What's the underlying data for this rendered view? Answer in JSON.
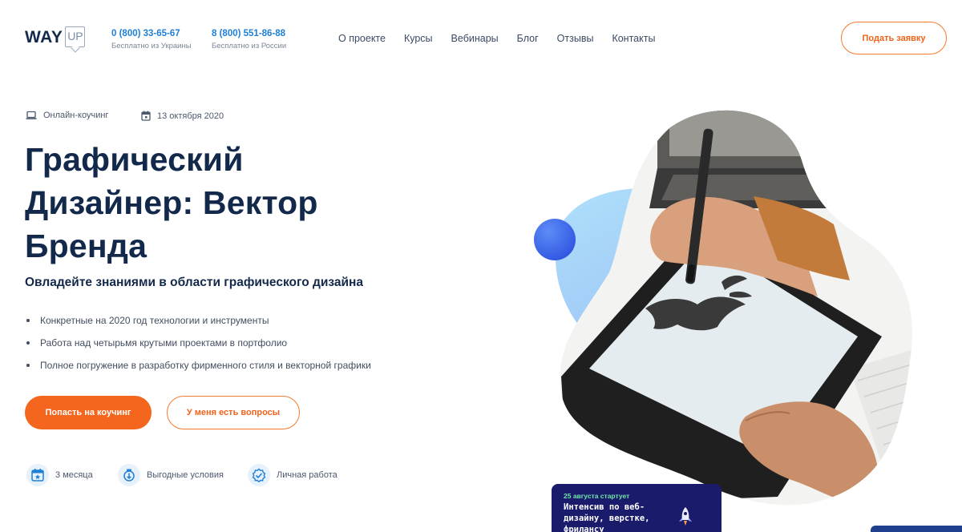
{
  "header": {
    "logo": {
      "way": "WAY",
      "up": "UP"
    },
    "phones": [
      {
        "number": "0 (800) 33-65-67",
        "note": "Бесплатно из Украины"
      },
      {
        "number": "8 (800) 551-86-88",
        "note": "Бесплатно из России"
      }
    ],
    "nav": [
      "О проекте",
      "Курсы",
      "Вебинары",
      "Блог",
      "Отзывы",
      "Контакты"
    ],
    "apply_button": "Подать заявку"
  },
  "meta": {
    "format": "Онлайн-коучинг",
    "date": "13 октября 2020"
  },
  "hero": {
    "title": "Графический Дизайнер: Вектор Бренда",
    "subtitle": "Овладейте знаниями в области графического дизайна",
    "bullets": [
      "Конкретные на 2020 год технологии и инструменты",
      "Работа над четырьмя крутыми проектами в портфолио",
      "Полное погружение в разработку фирменного стиля и векторной графики"
    ],
    "primary_button": "Попасть на коучинг",
    "secondary_button": "У меня есть вопросы"
  },
  "features": [
    {
      "label": "3 месяца",
      "icon": "calendar-star-icon"
    },
    {
      "label": "Выгодные условия",
      "icon": "piggy-bank-icon"
    },
    {
      "label": "Личная работа",
      "icon": "badge-icon"
    }
  ],
  "promo": {
    "date": "25 августа стартует",
    "title": "Интенсив по веб-дизайну, верстке, фрилансу"
  },
  "colors": {
    "accent": "#f4651d",
    "navy": "#13294b",
    "link_blue": "#1e7fd6",
    "promo_bg": "#1b1b6b",
    "promo_date": "#6ee7a7"
  }
}
